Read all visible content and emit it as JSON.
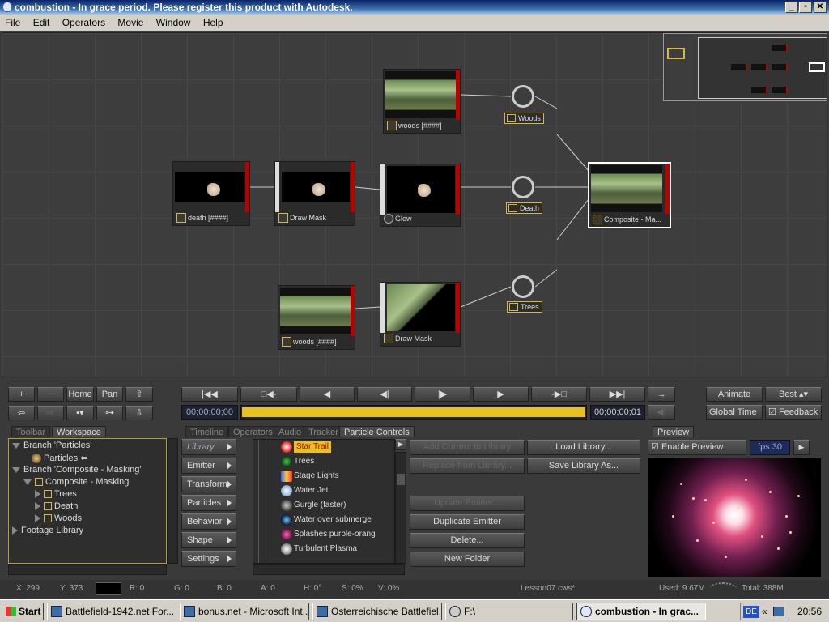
{
  "window": {
    "title": "combustion - In grace period. Please register this product with Autodesk."
  },
  "menu": [
    "File",
    "Edit",
    "Operators",
    "Movie",
    "Window",
    "Help"
  ],
  "schematic": {
    "nodes": {
      "woods_top": "woods [####]",
      "death_src": "death [####]",
      "draw_mask1": "Draw Mask",
      "glow": "Glow",
      "woods_bottom": "woods [####]",
      "draw_mask2": "Draw Mask",
      "composite": "Composite - Ma..."
    },
    "outputs": {
      "woods": "Woods",
      "death": "Death",
      "trees": "Trees"
    }
  },
  "view_toolbar": {
    "plus": "+",
    "minus": "−",
    "home": "Home",
    "pan": "Pan"
  },
  "transport": {
    "timecode_start": "00;00;00;00",
    "timecode_end": "00;00;00;01",
    "progress": 1.0
  },
  "right_toolbar": {
    "animate": "Animate",
    "quality": "Best",
    "global_time": "Global Time",
    "feedback": "Feedback"
  },
  "left_tabs": {
    "toolbar": "Toolbar",
    "workspace": "Workspace"
  },
  "workspace_tree": {
    "branch_particles": "Branch 'Particles'",
    "particles": "Particles",
    "branch_composite": "Branch 'Composite - Masking'",
    "composite_masking": "Composite - Masking",
    "trees": "Trees",
    "death": "Death",
    "woods": "Woods",
    "footage_library": "Footage Library"
  },
  "mid_tabs": [
    "Timeline",
    "Operators",
    "Audio",
    "Tracker",
    "Particle Controls"
  ],
  "particle_menu": [
    "Library",
    "Emitter",
    "Transform",
    "Particles",
    "Behavior",
    "Shape",
    "Settings"
  ],
  "library_items": [
    "Star Trail",
    "Trees",
    "Stage Lights",
    "Water Jet",
    "Gurgle (faster)",
    "Water over submerge",
    "Splashes purple-orang",
    "Turbulent Plasma"
  ],
  "library_actions": {
    "add_current": "Add Current to Library",
    "load_library": "Load Library...",
    "replace": "Replace from Library...",
    "save_library": "Save Library As...",
    "update_emitter": "Update Emitter...",
    "duplicate": "Duplicate Emitter",
    "delete": "Delete...",
    "new_folder": "New Folder"
  },
  "preview": {
    "tab": "Preview",
    "enable": "Enable Preview",
    "fps": "fps 30"
  },
  "status": {
    "x": "X:  299",
    "y": "Y:  373",
    "r": "R: 0",
    "g": "G: 0",
    "b": "B: 0",
    "a": "A: 0",
    "h": "H: 0°",
    "s": "S: 0%",
    "v": "V: 0%",
    "file": "Lesson07.cws*",
    "used": "Used: 9.67M",
    "total": "Total: 388M"
  },
  "taskbar": {
    "start": "Start",
    "tasks": [
      "Battlefield-1942.net For...",
      "bonus.net - Microsoft Int...",
      "Österreichische Battlefiel...",
      "F:\\",
      "combustion - In grac..."
    ],
    "lang": "DE",
    "time": "20:56"
  },
  "colors": {
    "accent": "#d8b84a",
    "node_red": "#b00000",
    "timeline_bar": "#e8c020"
  }
}
